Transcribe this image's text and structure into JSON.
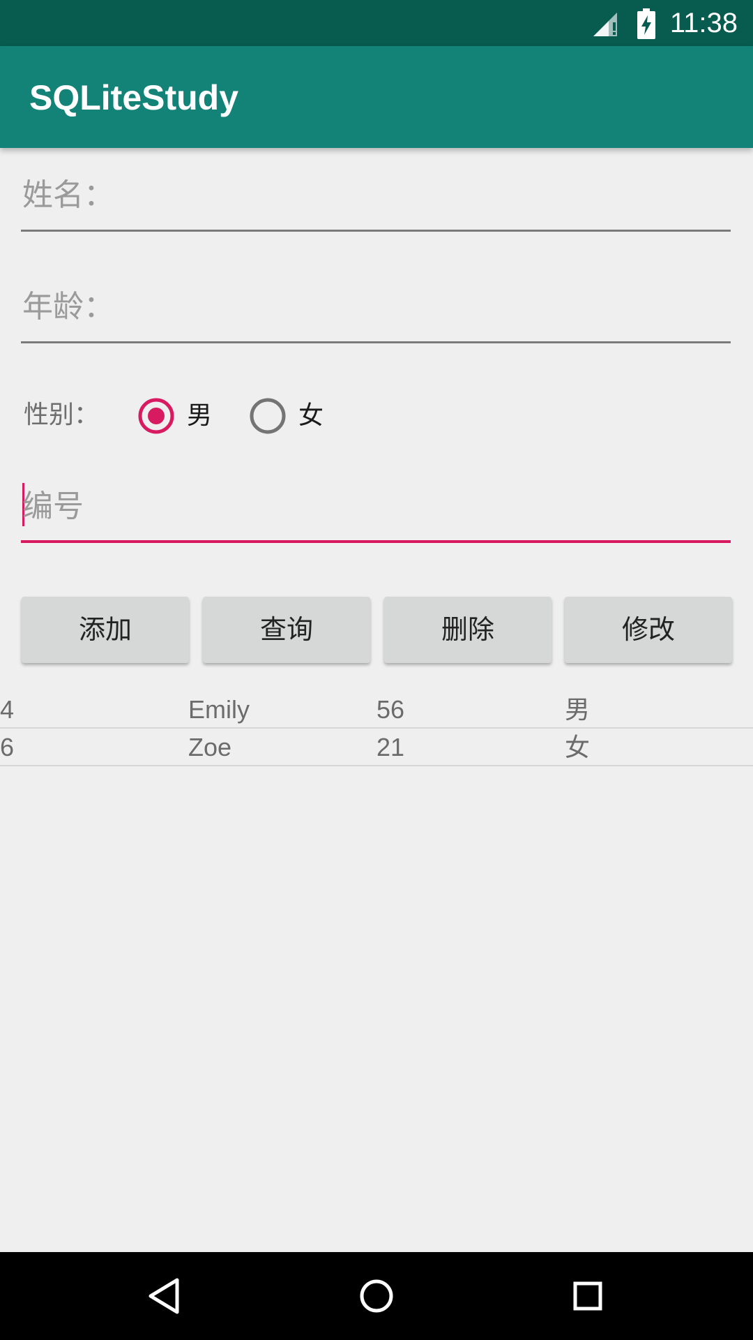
{
  "status_bar": {
    "time": "11:38",
    "icons": [
      "signal-icon",
      "battery-charging-icon"
    ]
  },
  "app_bar": {
    "title": "SQLiteStudy"
  },
  "form": {
    "name_placeholder": "姓名：",
    "age_placeholder": "年龄：",
    "gender_label": "性别：",
    "gender_options": [
      {
        "label": "男",
        "selected": true
      },
      {
        "label": "女",
        "selected": false
      }
    ],
    "id_placeholder": "编号"
  },
  "buttons": {
    "add": "添加",
    "query": "查询",
    "delete": "删除",
    "update": "修改"
  },
  "table": {
    "rows": [
      [
        "4",
        "Emily",
        "56",
        "男"
      ],
      [
        "6",
        "Zoe",
        "21",
        "女"
      ]
    ]
  },
  "nav_bar": {
    "icons": [
      "back-icon",
      "home-icon",
      "recents-icon"
    ]
  },
  "colors": {
    "primary_dark": "#075b4f",
    "primary": "#128376",
    "accent": "#d81b60"
  }
}
